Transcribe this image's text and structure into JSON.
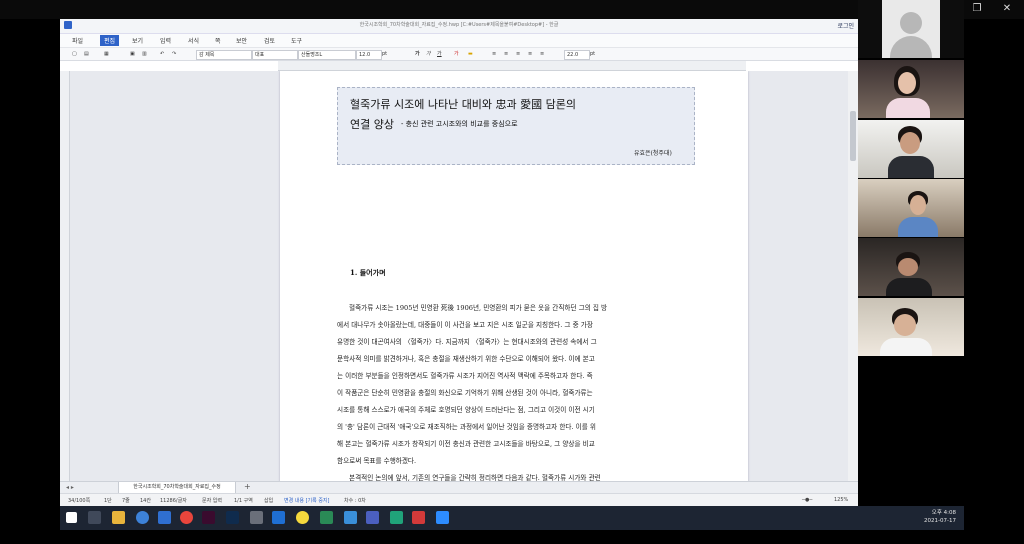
{
  "window": {
    "title": "한국시조학회_70차학술대회_자료집_수정.hwp [C:#Users#제목을붙여#Desktop#] - 한글",
    "login_label": "로그인",
    "controls": [
      "—",
      "❐",
      "✕"
    ]
  },
  "menu": [
    "파일",
    "편집",
    "보기",
    "입력",
    "서식",
    "쪽",
    "보안",
    "검토",
    "도구"
  ],
  "menu_active_index": 1,
  "toolbar": {
    "style_name": "감 제목",
    "font_lang": "대표",
    "font_name": "산돌명조L",
    "font_size": "12.0",
    "size_unit": "pt",
    "bold": "가",
    "italic": "가",
    "underline": "가",
    "line_spacing": "22.0",
    "spacing_unit": "pt"
  },
  "document": {
    "title_line1": "혈죽가류 시조에 나타난 대비와 忠과 愛國 담론의",
    "title_line2": "연결 양상",
    "subtitle": "- 충신 관련 고시조와의 비교를 중심으로",
    "author": "유효은(청주대)",
    "section_heading": "1. 들어가며",
    "body_lines": [
      "혈죽가류 시조는 1905년 민영환 死後 1906년, 민영환의 피가 묻은 옷을 간직하던 그의 집 방",
      "에서 대나무가 솟아올랐는데, 대중들이 이 사건을 보고 지은 시조 일군을 지칭한다. 그 중 가장",
      "유명한 것이 대곤여사의 〈혈죽가〉다. 지금까지 〈혈죽가〉는 현대시조와의 관련성 속에서 그",
      "문학사적 의미를 밝견하거나, 혹은 충절을 재생산하기 위한 수단으로 이해되어 왔다. 이에 본고",
      "는 이러한 부분들을 인정하면서도 혈죽가류 시조가 지어진 역사적 맥락에 주목하고자 한다. 즉",
      "이 작품군은 단순히 민영환을 충절의 화신으로 기억하기 위해 산생된 것이 아니라, 혈죽가류는",
      "시조를 통해 스스로가 애국의 주체로 호명되던 양상이 드러난다는 점, 그리고 이것이 이전 시기",
      "의 '충' 담론이 근대적 '애국'으로 재조직하는 과정에서 일어난 것임을 증명하고자 한다. 이를 위",
      "해 본고는 혈죽가류 시조가 창작되기 이전 충신과 관련한 고시조들을 바탕으로, 그 양상을 비교",
      "함으로써 목표를 수행하겠다.",
      "본격적인 논의에 앞서, 기존의 연구들을 간략히 정리하면 다음과 같다. 혈죽가류 시가와 관련"
    ],
    "tab_label": "한국시조학회_70차학술대회_자료집_수정"
  },
  "status": {
    "page": "34/100쪽",
    "section": "1단",
    "line": "7줄",
    "col": "14칸",
    "chars": "11286/글자",
    "input_mode": "문자 입력",
    "zone": "1/1 구역",
    "insert": "삽입",
    "track": "변경 내용 [기록 중지]",
    "nav": "차수 : 0차",
    "zoom": "125%"
  },
  "clock": {
    "time": "오후 4:08",
    "date": "2021-07-17"
  },
  "colors": {
    "accent": "#2f63c8",
    "title_box": "#e8ecf4",
    "taskbar": "#1d2533"
  }
}
